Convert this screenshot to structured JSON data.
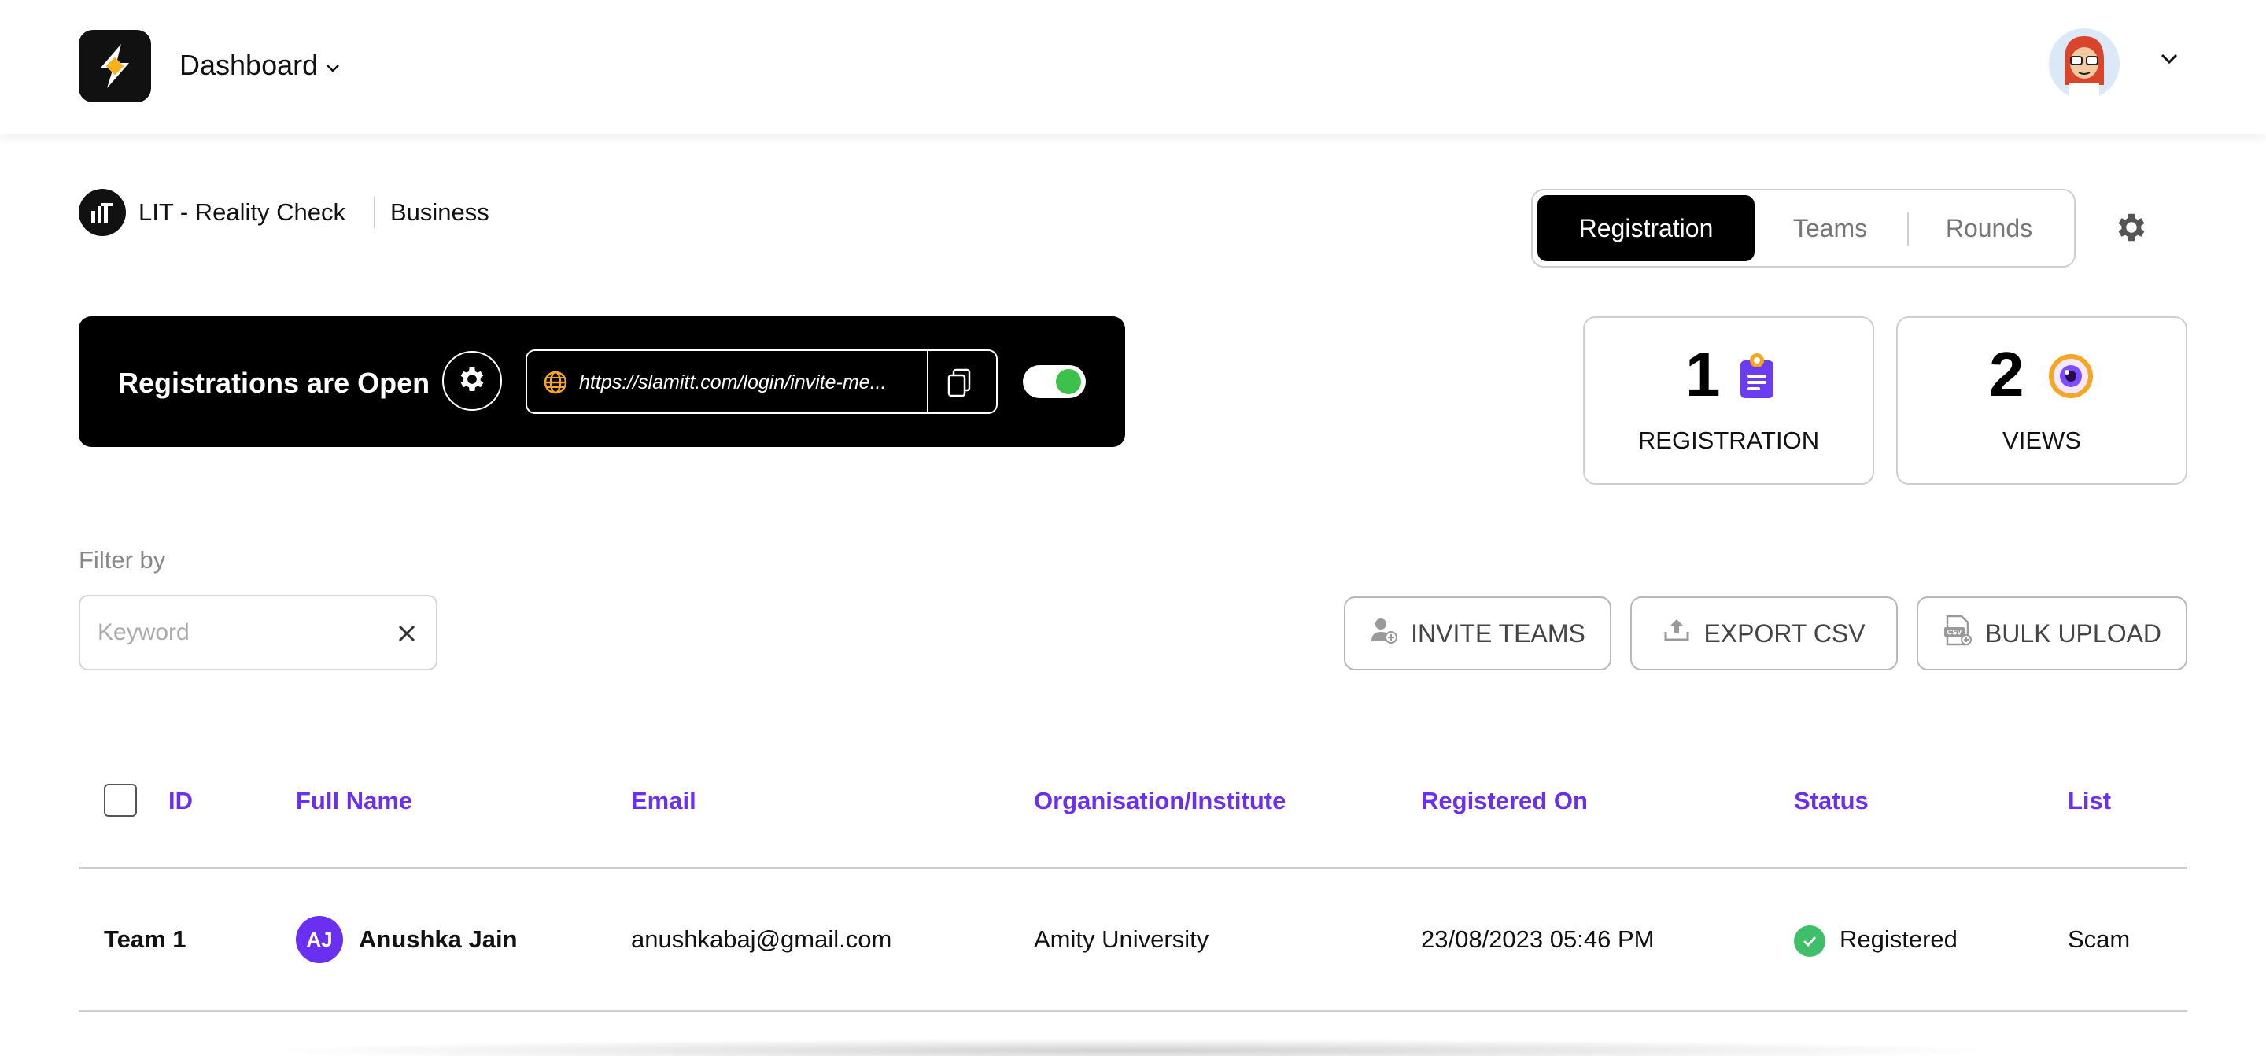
{
  "header": {
    "app_logo": "slamitt-logo",
    "dashboard_label": "Dashboard",
    "dashboard_chevron": "chevron-down-icon",
    "account_chevron": "chevron-down-icon"
  },
  "event": {
    "name": "LIT - Reality Check",
    "type": "Business"
  },
  "tabs": [
    {
      "label": "Registration",
      "active": true
    },
    {
      "label": "Teams",
      "active": false
    },
    {
      "label": "Rounds",
      "active": false
    }
  ],
  "registration_banner": {
    "title": "Registrations are Open",
    "url": "https://slamitt.com/login/invite-me...",
    "toggle_on": true
  },
  "stats": [
    {
      "value": "1",
      "label": "REGISTRATION",
      "icon": "clipboard-icon"
    },
    {
      "value": "2",
      "label": "VIEWS",
      "icon": "eye-icon"
    }
  ],
  "filter": {
    "label": "Filter by",
    "placeholder": "Keyword",
    "value": ""
  },
  "actions": {
    "invite": "INVITE TEAMS",
    "export": "EXPORT CSV",
    "bulk": "BULK UPLOAD"
  },
  "table": {
    "columns": [
      "ID",
      "Full Name",
      "Email",
      "Organisation/Institute",
      "Registered On",
      "Status",
      "List"
    ],
    "rows": [
      {
        "id": "Team 1",
        "initials": "AJ",
        "full_name": "Anushka Jain",
        "email": "anushkabaj@gmail.com",
        "organisation": "Amity University",
        "registered_on": "23/08/2023 05:46 PM",
        "status": "Registered",
        "list": "Scam"
      }
    ]
  },
  "colors": {
    "accent": "#6a2ff0",
    "success": "#3fbf6a",
    "toggle_on": "#3cc24a",
    "banner_bg": "#000000"
  }
}
